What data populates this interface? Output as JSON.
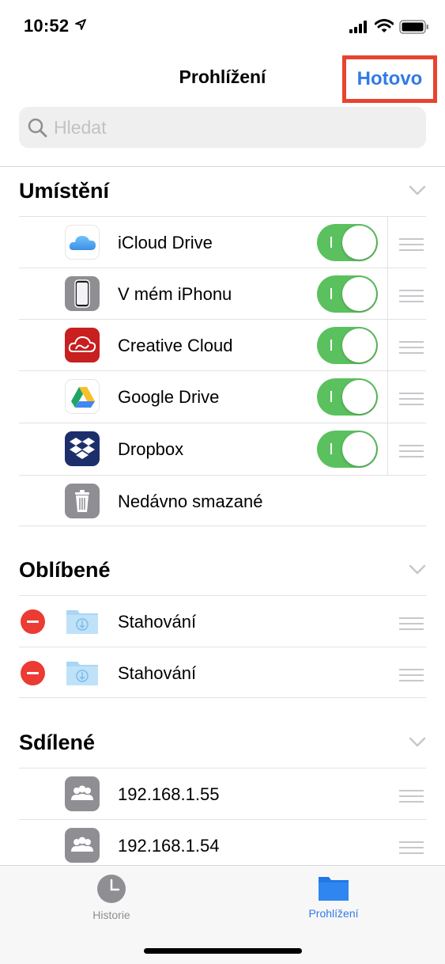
{
  "status_bar": {
    "time": "10:52"
  },
  "nav": {
    "title": "Prohlížení",
    "done_label": "Hotovo"
  },
  "search": {
    "placeholder": "Hledat"
  },
  "sections": {
    "locations": {
      "title": "Umístění",
      "items": [
        {
          "label": "iCloud Drive",
          "enabled": true
        },
        {
          "label": "V mém iPhonu",
          "enabled": true
        },
        {
          "label": "Creative Cloud",
          "enabled": true
        },
        {
          "label": "Google Drive",
          "enabled": true
        },
        {
          "label": "Dropbox",
          "enabled": true
        },
        {
          "label": "Nedávno smazané"
        }
      ]
    },
    "favorites": {
      "title": "Oblíbené",
      "items": [
        {
          "label": "Stahování"
        },
        {
          "label": "Stahování"
        }
      ]
    },
    "shared": {
      "title": "Sdílené",
      "items": [
        {
          "label": "192.168.1.55"
        },
        {
          "label": "192.168.1.54"
        }
      ]
    }
  },
  "tab_bar": {
    "tabs": [
      {
        "label": "Historie",
        "icon": "clock-icon",
        "active": false
      },
      {
        "label": "Prohlížení",
        "icon": "folder-icon",
        "active": true
      }
    ]
  },
  "colors": {
    "accent": "#2f7be6",
    "toggle_on": "#5ac15e",
    "delete": "#eb3b32",
    "highlight_box": "#e8432f"
  }
}
